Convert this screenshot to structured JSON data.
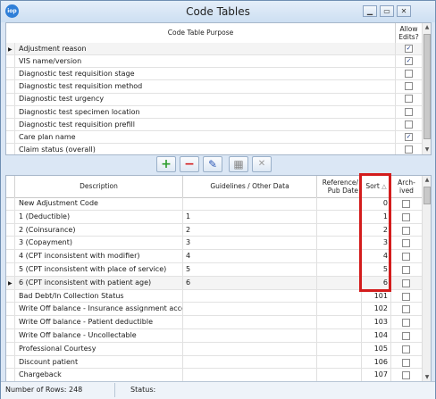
{
  "window": {
    "title": "Code Tables",
    "app_icon": "iop",
    "controls": [
      "▁",
      "▭",
      "✕"
    ]
  },
  "top_table": {
    "headers": {
      "purpose": "Code Table Purpose",
      "allow_edits": "Allow Edits?"
    },
    "rows": [
      {
        "label": "Adjustment reason",
        "checked": true,
        "current": true
      },
      {
        "label": "VIS name/version",
        "checked": true,
        "current": false
      },
      {
        "label": "Diagnostic test requisition stage",
        "checked": false,
        "current": false
      },
      {
        "label": "Diagnostic test requisition method",
        "checked": false,
        "current": false
      },
      {
        "label": "Diagnostic test urgency",
        "checked": false,
        "current": false
      },
      {
        "label": "Diagnostic test specimen location",
        "checked": false,
        "current": false
      },
      {
        "label": "Diagnostic test requisition prefill",
        "checked": false,
        "current": false
      },
      {
        "label": "Care plan name",
        "checked": true,
        "current": false
      },
      {
        "label": "Claim status (overall)",
        "checked": false,
        "current": false
      }
    ]
  },
  "toolbar": {
    "add_icon": "+",
    "remove_icon": "−",
    "edit_icon": "✎",
    "grid_icon": "▦",
    "cancel_icon": "✕"
  },
  "bottom_table": {
    "headers": {
      "description": "Description",
      "guidelines": "Guidelines / Other Data",
      "reference": "Reference/ Pub Date",
      "sort": "Sort",
      "sort_indicator": "△",
      "archived": "Arch- ived"
    },
    "rows": [
      {
        "description": "New Adjustment Code",
        "guidelines": "",
        "sort": "0",
        "current": false
      },
      {
        "description": "1 (Deductible)",
        "guidelines": "1",
        "sort": "1",
        "current": false
      },
      {
        "description": "2 (Coinsurance)",
        "guidelines": "2",
        "sort": "2",
        "current": false
      },
      {
        "description": "3 (Copayment)",
        "guidelines": "3",
        "sort": "3",
        "current": false
      },
      {
        "description": "4 (CPT inconsistent with modifier)",
        "guidelines": "4",
        "sort": "4",
        "current": false
      },
      {
        "description": "5 (CPT inconsistent with place of service)",
        "guidelines": "5",
        "sort": "5",
        "current": false
      },
      {
        "description": "6 (CPT inconsistent with patient age)",
        "guidelines": "6",
        "sort": "6",
        "current": true
      },
      {
        "description": "Bad Debt/In Collection Status",
        "guidelines": "",
        "sort": "101",
        "current": false
      },
      {
        "description": "Write Off balance - Insurance assignment accepted",
        "guidelines": "",
        "sort": "102",
        "current": false
      },
      {
        "description": "Write Off balance - Patient deductible",
        "guidelines": "",
        "sort": "103",
        "current": false
      },
      {
        "description": "Write Off balance - Uncollectable",
        "guidelines": "",
        "sort": "104",
        "current": false
      },
      {
        "description": "Professional Courtesy",
        "guidelines": "",
        "sort": "105",
        "current": false
      },
      {
        "description": "Discount patient",
        "guidelines": "",
        "sort": "106",
        "current": false
      },
      {
        "description": "Chargeback",
        "guidelines": "",
        "sort": "107",
        "current": false
      }
    ]
  },
  "status_bar": {
    "rows_label": "Number of Rows: 248",
    "status_label": "Status:"
  }
}
